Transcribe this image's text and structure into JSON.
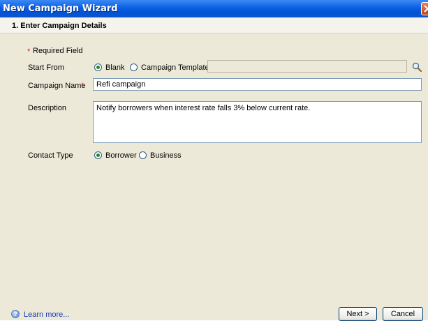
{
  "window": {
    "title": "New Campaign Wizard"
  },
  "step": {
    "title": "1. Enter Campaign Details"
  },
  "form": {
    "required_star": "*",
    "required_note": "Required Field",
    "start_from": {
      "label": "Start From",
      "options": [
        {
          "label": "Blank",
          "checked": true
        },
        {
          "label": "Campaign Template",
          "checked": false
        }
      ],
      "template_value": ""
    },
    "campaign_name": {
      "label": "Campaign Name",
      "required_star": "*",
      "value": "Refi campaign"
    },
    "description": {
      "label": "Description",
      "value": "Notify borrowers when interest rate falls 3% below current rate."
    },
    "contact_type": {
      "label": "Contact Type",
      "options": [
        {
          "label": "Borrower",
          "checked": true
        },
        {
          "label": "Business",
          "checked": false
        }
      ]
    }
  },
  "footer": {
    "learn_more": "Learn more...",
    "next_label": "Next >",
    "cancel_label": "Cancel"
  },
  "icons": {
    "close": "close-icon",
    "search": "search-icon",
    "help": "help-icon"
  },
  "colors": {
    "titlebar": "#0a5fe3",
    "panel": "#ece9d8",
    "radio_dot": "#1e8a1e",
    "link": "#1a3fb3",
    "required": "#d42020"
  }
}
